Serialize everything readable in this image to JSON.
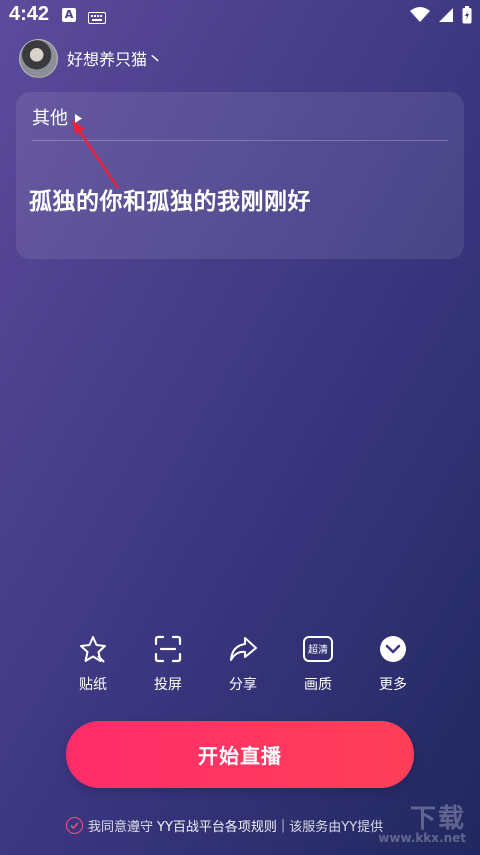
{
  "status_bar": {
    "time": "4:42",
    "left_icons": [
      "a-notification-icon",
      "keyboard-icon"
    ],
    "right_icons": [
      "wifi-icon",
      "signal-icon",
      "battery-icon"
    ]
  },
  "user": {
    "name": "好想养只猫丶",
    "avatar_icon": "avatar"
  },
  "card": {
    "category_label": "其他",
    "category_caret_icon": "play-triangle-icon",
    "title": "孤独的你和孤独的我刚刚好"
  },
  "tools": [
    {
      "label": "贴纸",
      "icon": "star-sticker-icon"
    },
    {
      "label": "投屏",
      "icon": "screen-cast-icon"
    },
    {
      "label": "分享",
      "icon": "share-arrow-icon"
    },
    {
      "label": "画质",
      "icon": "hd-quality-icon",
      "badge": "超清"
    },
    {
      "label": "更多",
      "icon": "chevron-down-icon"
    }
  ],
  "start_button": {
    "label": "开始直播"
  },
  "agreement": {
    "prefix": "我同意遵守",
    "link": "YY百战平台各项规则",
    "separator": "|",
    "suffix": "该服务由YY提供"
  },
  "watermark": {
    "text": "下载",
    "url": "www.kkx.net"
  },
  "colors": {
    "bg_start": "#5d4b9b",
    "bg_end": "#20285f",
    "accent": "#ff2c6a",
    "annotation": "#e8223a"
  }
}
